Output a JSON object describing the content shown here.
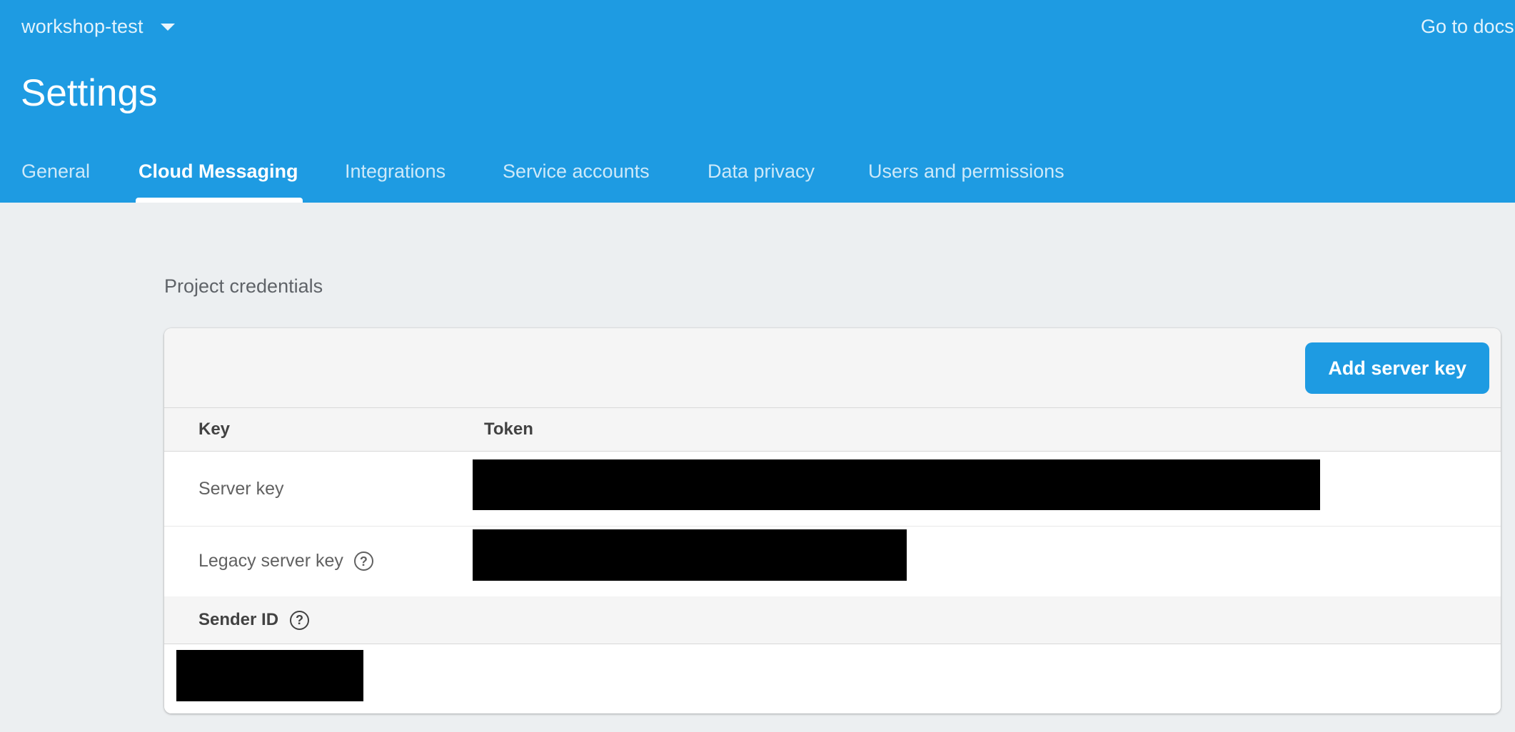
{
  "header": {
    "project_name": "workshop-test",
    "docs_link": "Go to docs",
    "page_title": "Settings",
    "tabs": [
      {
        "label": "General",
        "active": false
      },
      {
        "label": "Cloud Messaging",
        "active": true
      },
      {
        "label": "Integrations",
        "active": false
      },
      {
        "label": "Service accounts",
        "active": false
      },
      {
        "label": "Data privacy",
        "active": false
      },
      {
        "label": "Users and permissions",
        "active": false
      }
    ]
  },
  "credentials": {
    "section_label": "Project credentials",
    "add_button_label": "Add server key",
    "columns": [
      "Key",
      "Token"
    ],
    "rows": [
      {
        "key": "Server key",
        "has_help": false
      },
      {
        "key": "Legacy server key",
        "has_help": true
      }
    ],
    "sender_id_label": "Sender ID",
    "help_glyph": "?"
  },
  "colors": {
    "header_bg": "#1e9be2",
    "page_bg": "#eceff1",
    "accent": "#1e9be2"
  }
}
